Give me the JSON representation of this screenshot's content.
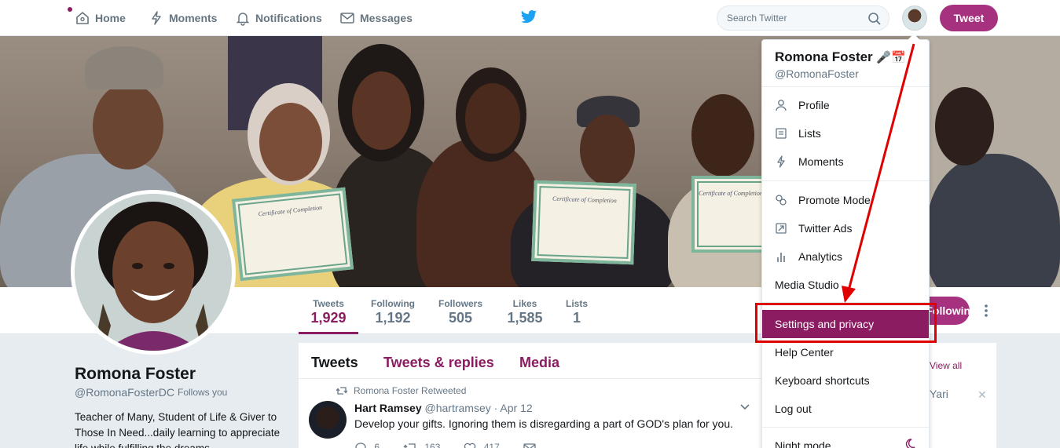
{
  "nav": {
    "home": "Home",
    "moments": "Moments",
    "notifications": "Notifications",
    "messages": "Messages",
    "search_placeholder": "Search Twitter",
    "tweet_button": "Tweet"
  },
  "banner": {
    "certificates": [
      "Certificate of Completion",
      "Certificate of Completion",
      "Certificate of Completion"
    ]
  },
  "stats": [
    {
      "label": "Tweets",
      "value": "1,929"
    },
    {
      "label": "Following",
      "value": "1,192"
    },
    {
      "label": "Followers",
      "value": "505"
    },
    {
      "label": "Likes",
      "value": "1,585"
    },
    {
      "label": "Lists",
      "value": "1"
    }
  ],
  "follow_button": "Following",
  "profile": {
    "name": "Romona Foster",
    "handle": "@RomonaFosterDC",
    "follows_you": "Follows you",
    "bio": "Teacher of Many, Student of Life & Giver to Those In Need...daily learning to appreciate life while fulfilling the dreams"
  },
  "timeline": {
    "tabs": [
      "Tweets",
      "Tweets & replies",
      "Media"
    ],
    "retweeted_by": "Romona Foster Retweeted",
    "tweet": {
      "name": "Hart Ramsey",
      "handle": "@hartramsey",
      "date": "· Apr 12",
      "text": "Develop your gifts. Ignoring them is disregarding a part of GOD's plan for you.",
      "replies": "6",
      "retweets": "163",
      "likes": "417"
    }
  },
  "right_panel": {
    "view_all": "View all",
    "suggestion": "Yari"
  },
  "menu": {
    "name": "Romona Foster",
    "emoji": "🎤📅",
    "handle": "@RomonaFoster",
    "items": [
      "Profile",
      "Lists",
      "Moments",
      "Promote Mode",
      "Twitter Ads",
      "Analytics",
      "Media Studio",
      "Settings and privacy",
      "Help Center",
      "Keyboard shortcuts",
      "Log out",
      "Night mode"
    ]
  },
  "colors": {
    "accent": "#8b1c62",
    "button": "#a5317f",
    "annotation": "#e00000"
  }
}
